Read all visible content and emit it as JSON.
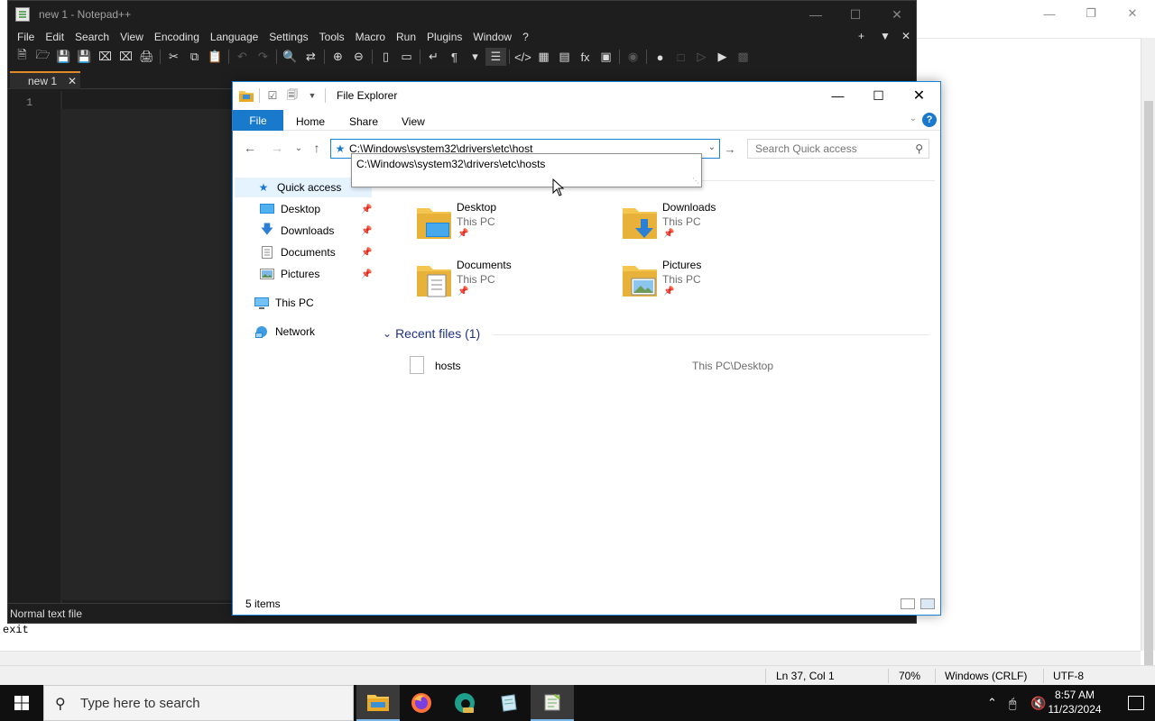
{
  "background_editor": {
    "exit_text": "exit",
    "status": {
      "position": "Ln 37, Col 1",
      "zoom": "70%",
      "eol": "Windows (CRLF)",
      "encoding": "UTF-8"
    }
  },
  "notepadpp": {
    "title": "new 1 - Notepad++",
    "menu": [
      "File",
      "Edit",
      "Search",
      "View",
      "Encoding",
      "Language",
      "Settings",
      "Tools",
      "Macro",
      "Run",
      "Plugins",
      "Window",
      "?"
    ],
    "tab_label": "new 1",
    "line_number": "1",
    "status_type": "Normal text file"
  },
  "explorer": {
    "title": "File Explorer",
    "ribbon_tabs": {
      "file": "File",
      "home": "Home",
      "share": "Share",
      "view": "View"
    },
    "address_value": "C:\\Windows\\system32\\drivers\\etc\\host",
    "address_suggestion": "C:\\Windows\\system32\\drivers\\etc\\hosts",
    "search_placeholder": "Search Quick access",
    "sidebar": {
      "quick_access": "Quick access",
      "desktop": "Desktop",
      "downloads": "Downloads",
      "documents": "Documents",
      "pictures": "Pictures",
      "this_pc": "This PC",
      "network": "Network"
    },
    "folders": [
      {
        "name": "Desktop",
        "location": "This PC"
      },
      {
        "name": "Downloads",
        "location": "This PC"
      },
      {
        "name": "Documents",
        "location": "This PC"
      },
      {
        "name": "Pictures",
        "location": "This PC"
      }
    ],
    "recent_header": "Recent files (1)",
    "recent_files": [
      {
        "name": "hosts",
        "location": "This PC\\Desktop"
      }
    ],
    "item_count": "5 items"
  },
  "taskbar": {
    "search_placeholder": "Type here to search",
    "time": "8:57 AM",
    "date": "11/23/2024"
  },
  "colors": {
    "accent": "#1979ca",
    "npp_bg": "#1e1e1e",
    "taskbar_bg": "#101010"
  }
}
